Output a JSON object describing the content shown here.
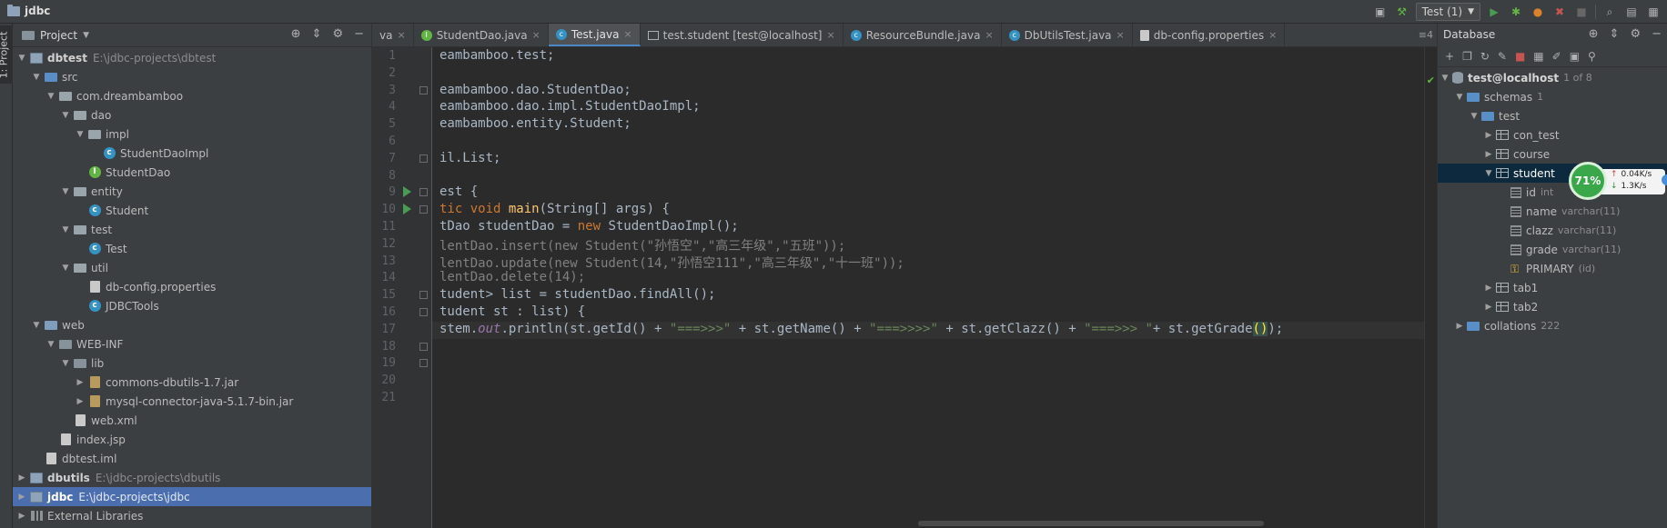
{
  "window": {
    "title": "jdbc"
  },
  "toolbar": {
    "run_config": "Test (1)"
  },
  "tool_strip": {
    "label": "1: Project"
  },
  "project_panel": {
    "title": "Project",
    "tree": [
      {
        "depth": 0,
        "arrow": "down",
        "icon": "module",
        "name": "dbtest",
        "path": "E:\\jdbc-projects\\dbtest",
        "bold": true
      },
      {
        "depth": 1,
        "arrow": "down",
        "icon": "folder-src",
        "name": "src"
      },
      {
        "depth": 2,
        "arrow": "down",
        "icon": "folder-pkg",
        "name": "com.dreambamboo"
      },
      {
        "depth": 3,
        "arrow": "down",
        "icon": "folder-pkg",
        "name": "dao"
      },
      {
        "depth": 4,
        "arrow": "down",
        "icon": "folder-pkg",
        "name": "impl"
      },
      {
        "depth": 5,
        "arrow": "",
        "icon": "class",
        "name": "StudentDaoImpl"
      },
      {
        "depth": 4,
        "arrow": "",
        "icon": "interface",
        "name": "StudentDao"
      },
      {
        "depth": 3,
        "arrow": "down",
        "icon": "folder-pkg",
        "name": "entity"
      },
      {
        "depth": 4,
        "arrow": "",
        "icon": "class",
        "name": "Student"
      },
      {
        "depth": 3,
        "arrow": "down",
        "icon": "folder-pkg",
        "name": "test"
      },
      {
        "depth": 4,
        "arrow": "",
        "icon": "class",
        "name": "Test"
      },
      {
        "depth": 3,
        "arrow": "down",
        "icon": "folder-pkg",
        "name": "util"
      },
      {
        "depth": 4,
        "arrow": "",
        "icon": "file",
        "name": "db-config.properties"
      },
      {
        "depth": 4,
        "arrow": "",
        "icon": "class",
        "name": "JDBCTools"
      },
      {
        "depth": 1,
        "arrow": "down",
        "icon": "folder-web",
        "name": "web"
      },
      {
        "depth": 2,
        "arrow": "down",
        "icon": "folder",
        "name": "WEB-INF"
      },
      {
        "depth": 3,
        "arrow": "down",
        "icon": "folder",
        "name": "lib"
      },
      {
        "depth": 4,
        "arrow": "right",
        "icon": "jar",
        "name": "commons-dbutils-1.7.jar"
      },
      {
        "depth": 4,
        "arrow": "right",
        "icon": "jar",
        "name": "mysql-connector-java-5.1.7-bin.jar"
      },
      {
        "depth": 3,
        "arrow": "",
        "icon": "file",
        "name": "web.xml"
      },
      {
        "depth": 2,
        "arrow": "",
        "icon": "file",
        "name": "index.jsp"
      },
      {
        "depth": 1,
        "arrow": "",
        "icon": "file",
        "name": "dbtest.iml"
      },
      {
        "depth": 0,
        "arrow": "right",
        "icon": "module",
        "name": "dbutils",
        "path": "E:\\jdbc-projects\\dbutils",
        "bold": true
      },
      {
        "depth": 0,
        "arrow": "right",
        "icon": "module",
        "name": "jdbc",
        "path": "E:\\jdbc-projects\\jdbc",
        "bold": true,
        "selected": true
      },
      {
        "depth": 0,
        "arrow": "right",
        "icon": "lib",
        "name": "External Libraries"
      }
    ]
  },
  "editor": {
    "tabs": [
      {
        "label": "va",
        "icon": "",
        "active": false,
        "closable": true
      },
      {
        "label": "StudentDao.java",
        "icon": "interface",
        "active": false,
        "closable": true
      },
      {
        "label": "Test.java",
        "icon": "class",
        "active": true,
        "closable": true
      },
      {
        "label": "test.student [test@localhost]",
        "icon": "table",
        "active": false,
        "closable": true
      },
      {
        "label": "ResourceBundle.java",
        "icon": "class",
        "active": false,
        "closable": true
      },
      {
        "label": "DbUtilsTest.java",
        "icon": "class",
        "active": false,
        "closable": true
      },
      {
        "label": "db-config.properties",
        "icon": "props",
        "active": false,
        "closable": true
      }
    ],
    "tab_overflow": "≡4",
    "line_numbers": [
      "1",
      "2",
      "3",
      "4",
      "5",
      "6",
      "7",
      "8",
      "9",
      "10",
      "11",
      "12",
      "13",
      "14",
      "15",
      "16",
      "17",
      "18",
      "19",
      "20",
      "21"
    ],
    "run_markers": [
      9,
      10
    ],
    "fold_markers": [
      3,
      7,
      9,
      10,
      15,
      16,
      18,
      19
    ],
    "caret_line": 17,
    "lines": [
      [
        {
          "t": "eambamboo.test;",
          "c": ""
        }
      ],
      [],
      [
        {
          "t": "eambamboo.dao.StudentDao;",
          "c": ""
        }
      ],
      [
        {
          "t": "eambamboo.dao.impl.StudentDaoImpl;",
          "c": ""
        }
      ],
      [
        {
          "t": "eambamboo.entity.Student;",
          "c": ""
        }
      ],
      [],
      [
        {
          "t": "il.List;",
          "c": ""
        }
      ],
      [],
      [
        {
          "t": "est {",
          "c": ""
        }
      ],
      [
        {
          "t": "tic void ",
          "c": "kw"
        },
        {
          "t": "main",
          "c": "fn"
        },
        {
          "t": "(String[] args) {",
          "c": ""
        }
      ],
      [
        {
          "t": "tDao studentDao = ",
          "c": ""
        },
        {
          "t": "new ",
          "c": "kw"
        },
        {
          "t": "StudentDaoImpl();",
          "c": ""
        }
      ],
      [
        {
          "t": "lentDao.insert(new Student(\"孙悟空\",\"高三年级\",\"五班\"));",
          "c": "cm"
        }
      ],
      [
        {
          "t": "lentDao.update(new Student(14,\"孙悟空111\",\"高三年级\",\"十一班\"));",
          "c": "cm"
        }
      ],
      [
        {
          "t": "lentDao.delete(14);",
          "c": "cm"
        }
      ],
      [
        {
          "t": "tudent> list = studentDao.findAll();",
          "c": ""
        }
      ],
      [
        {
          "t": "tudent st : list) {",
          "c": ""
        }
      ],
      [
        {
          "t": "stem.",
          "c": ""
        },
        {
          "t": "out",
          "c": "it"
        },
        {
          "t": ".println(st.getId() + ",
          "c": ""
        },
        {
          "t": "\"===>>>\"",
          "c": "str"
        },
        {
          "t": " + st.getName() + ",
          "c": ""
        },
        {
          "t": "\"===>>>>\"",
          "c": "str"
        },
        {
          "t": " + st.getClazz() + ",
          "c": ""
        },
        {
          "t": "\"===>>> \"",
          "c": "str"
        },
        {
          "t": "+ st.getGrade",
          "c": ""
        },
        {
          "t": "(",
          "c": "brk"
        },
        {
          "t": ")",
          "c": "brk"
        },
        {
          "t": ");",
          "c": ""
        }
      ],
      [],
      [],
      [],
      []
    ]
  },
  "db_panel": {
    "title": "Database",
    "tree": [
      {
        "depth": 0,
        "arrow": "down",
        "icon": "db",
        "name": "test@localhost",
        "meta": "1 of 8",
        "bold": true
      },
      {
        "depth": 1,
        "arrow": "down",
        "icon": "schema",
        "name": "schemas",
        "meta": "1"
      },
      {
        "depth": 2,
        "arrow": "down",
        "icon": "schema",
        "name": "test"
      },
      {
        "depth": 3,
        "arrow": "right",
        "icon": "table",
        "name": "con_test"
      },
      {
        "depth": 3,
        "arrow": "right",
        "icon": "table",
        "name": "course"
      },
      {
        "depth": 3,
        "arrow": "down",
        "icon": "table",
        "name": "student",
        "selected": true
      },
      {
        "depth": 4,
        "arrow": "",
        "icon": "column",
        "name": "id",
        "meta": "int"
      },
      {
        "depth": 4,
        "arrow": "",
        "icon": "column",
        "name": "name",
        "meta": "varchar(11)"
      },
      {
        "depth": 4,
        "arrow": "",
        "icon": "column",
        "name": "clazz",
        "meta": "varchar(11)"
      },
      {
        "depth": 4,
        "arrow": "",
        "icon": "column",
        "name": "grade",
        "meta": "varchar(11)"
      },
      {
        "depth": 4,
        "arrow": "",
        "icon": "key",
        "name": "PRIMARY",
        "meta": "(id)"
      },
      {
        "depth": 3,
        "arrow": "right",
        "icon": "table",
        "name": "tab1"
      },
      {
        "depth": 3,
        "arrow": "right",
        "icon": "table",
        "name": "tab2"
      },
      {
        "depth": 1,
        "arrow": "right",
        "icon": "schema",
        "name": "collations",
        "meta": "222"
      }
    ]
  },
  "net_widget": {
    "percent": "71%",
    "up": "0.04K/s",
    "down": "1.3K/s"
  }
}
